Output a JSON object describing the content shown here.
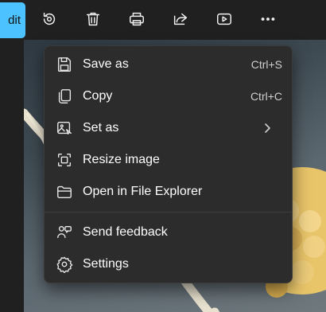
{
  "toolbar": {
    "edit_label": "dit",
    "icons": [
      "rotate-icon",
      "delete-icon",
      "print-icon",
      "share-icon",
      "slideshow-icon",
      "more-icon"
    ]
  },
  "menu": {
    "items": [
      {
        "label": "Save as",
        "shortcut": "Ctrl+S",
        "icon": "save-icon"
      },
      {
        "label": "Copy",
        "shortcut": "Ctrl+C",
        "icon": "copy-icon"
      },
      {
        "label": "Set as",
        "icon": "set-as-icon",
        "submenu": true
      },
      {
        "label": "Resize image",
        "icon": "resize-icon"
      },
      {
        "label": "Open in File Explorer",
        "icon": "folder-icon"
      },
      {
        "label": "Send feedback",
        "icon": "feedback-icon"
      },
      {
        "label": "Settings",
        "icon": "settings-icon"
      }
    ]
  },
  "colors": {
    "accent": "#4cc2ff",
    "menu_bg": "#2c2c2c",
    "toolbar_bg": "#202020"
  }
}
